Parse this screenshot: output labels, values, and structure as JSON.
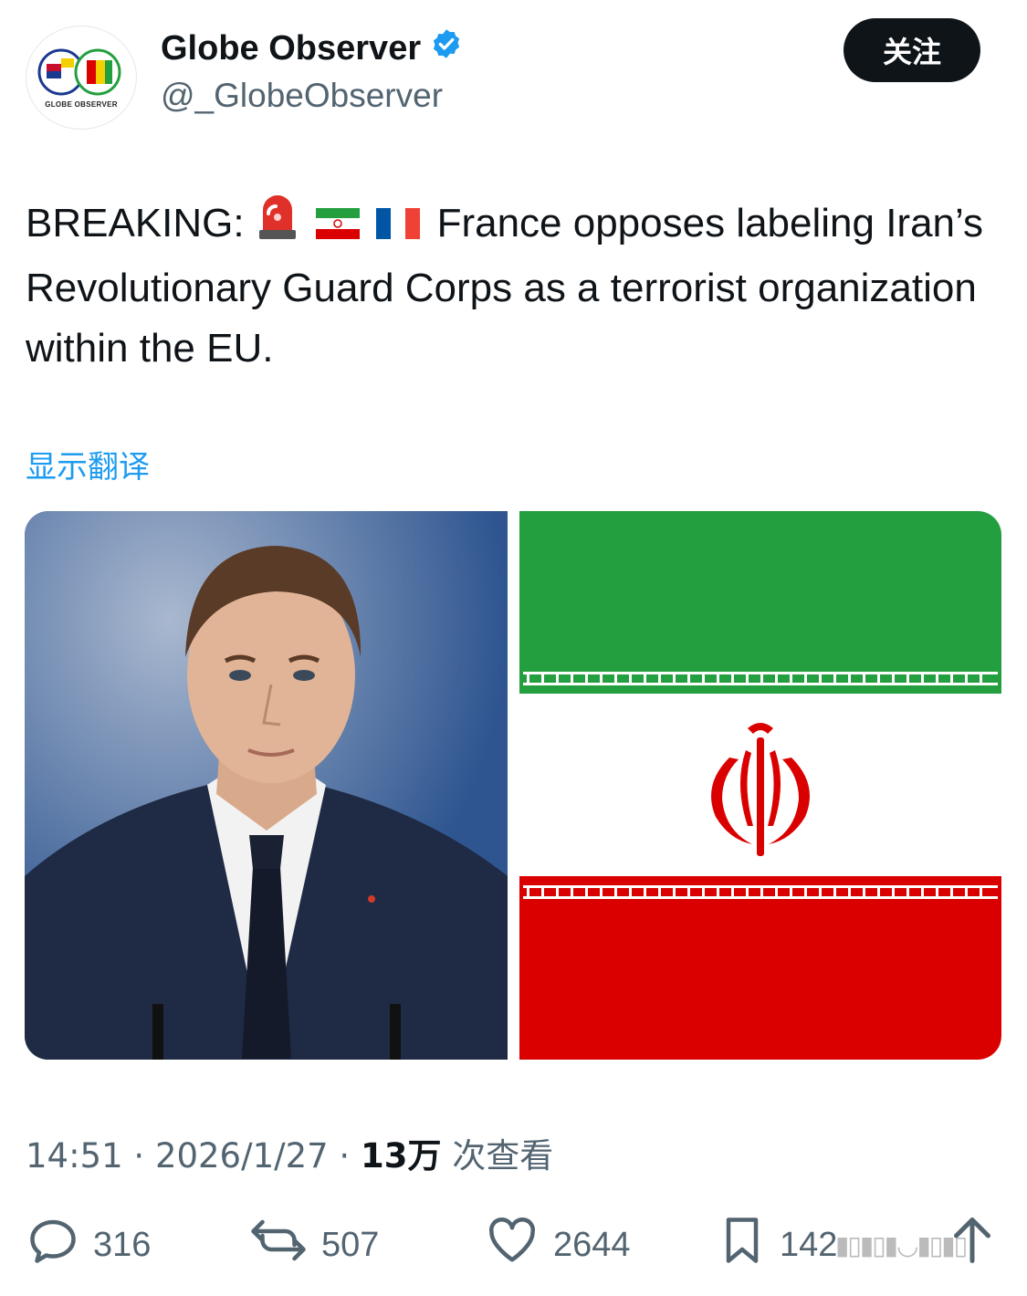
{
  "account": {
    "name": "Globe Observer",
    "handle": "@_GlobeObserver",
    "logo_text": "GO",
    "logo_caption": "GLOBE OBSERVER",
    "verified": true
  },
  "follow_label": "关注",
  "tweet": {
    "breaking_prefix": "BREAKING:",
    "emojis": [
      "police-light",
      "iran-flag",
      "france-flag"
    ],
    "body": "France opposes labeling Iran’s Revolutionary Guard Corps as a terrorist organization within the EU.",
    "translate_label": "显示翻译"
  },
  "media": {
    "left": "portrait-photo",
    "right": "iran-flag-image"
  },
  "meta": {
    "time": "14:51",
    "separator": "·",
    "date": "2026/1/27",
    "views_count": "13万",
    "views_suffix": "次查看"
  },
  "actions": {
    "replies": "316",
    "reposts": "507",
    "likes": "2644",
    "bookmarks": "142"
  },
  "colors": {
    "accent_link": "#1d9bf0",
    "verified_badge": "#1d9bf0",
    "text_primary": "#0f1419",
    "text_secondary": "#536471",
    "flag_green": "#239f40",
    "flag_red": "#da0000"
  }
}
